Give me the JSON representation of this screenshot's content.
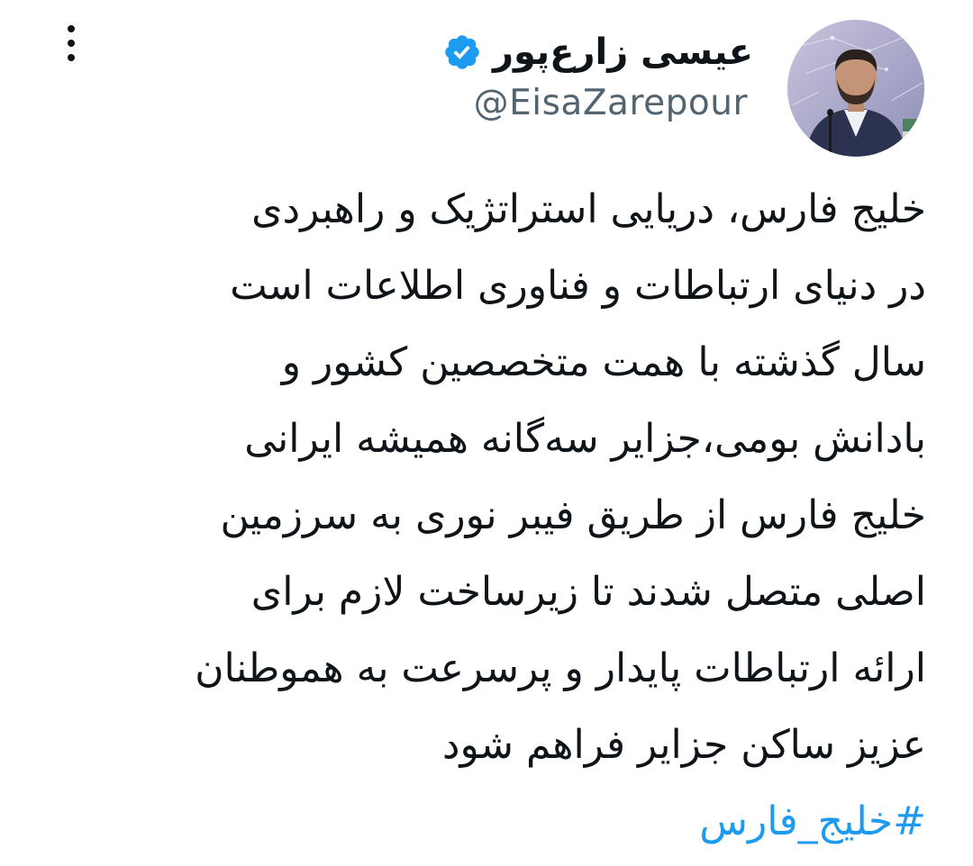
{
  "author": {
    "display_name": "عیسی زارع‌پور",
    "handle": "@EisaZarepour",
    "verified": true
  },
  "icons": {
    "verified": "verified-badge-icon",
    "more": "more-vertical-icon"
  },
  "colors": {
    "accent": "#1d9bf0",
    "text": "#0f1419",
    "secondary": "#536471"
  },
  "tweet": {
    "lines": [
      "خلیج فارس، دریایی استراتژیک و راهبردی",
      "در دنیای ارتباطات و فناوری اطلاعات است",
      "سال گذشته با همت متخصصین کشور و",
      "بادانش بومی،جزایر سه‌گانه همیشه ایرانی",
      "خلیج فارس از طریق فیبر نوری به سرزمین",
      "اصلی متصل شدند تا زیرساخت لازم برای",
      "ارائه ارتباطات پایدار و پرسرعت به هموطنان",
      "عزیز ساکن جزایر فراهم شود"
    ],
    "hashtag": "#خلیج_فارس"
  }
}
